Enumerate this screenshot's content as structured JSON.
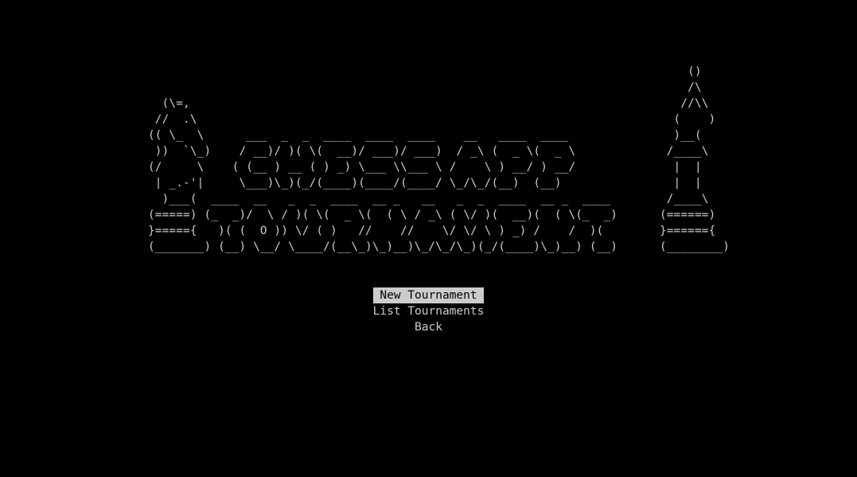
{
  "banner": {
    "art": "                                                                             ()\n                                                                             /\\\n  (\\=,                                                                      //\\\\\n //  .\\                                                                    (    )\n(( \\_  \\      ___  _  _  ____  ____  ____    __   ____  ____               )__(\n ))  `\\_)    / __)/ )( \\(  __)/ ___)/ ___)  / _\\ (  _ \\(  _ \\             /____\\\n(/     \\    ( (__ ) __ ( ) _) \\___ \\\\___ \\ /    \\ ) __/ ) __/              |  |\n | _.-'|     \\___)\\_)(_/(____)(____/(____/ \\_/\\_/(__)  (__)                |  |\n  )___(  ____  __   _  _  ____  __ _   __   _  _  ____  __ _  ____        /____\\\n(=====) (_  _)/  \\ / )( \\(  _ \\(  ( \\ / _\\ ( \\/ )(  __)(  ( \\(_  _)      (======)\n}====={   )( (  O )) \\/ ( )   //    //    \\/ \\/ \\ ) _) /    /  )(        }======{\n(_______) (__) \\__/ \\____/(__\\_)\\_)__)\\_/\\_/\\_)(_/(____)\\_)__) (__)      (________)"
  },
  "menu": {
    "items": [
      {
        "label": "New Tournament",
        "selected": true
      },
      {
        "label": "List Tournaments",
        "selected": false
      },
      {
        "label": "Back",
        "selected": false
      }
    ]
  },
  "colors": {
    "background": "#000000",
    "foreground": "#cccccc",
    "selection_bg": "#cccccc",
    "selection_fg": "#000000"
  }
}
